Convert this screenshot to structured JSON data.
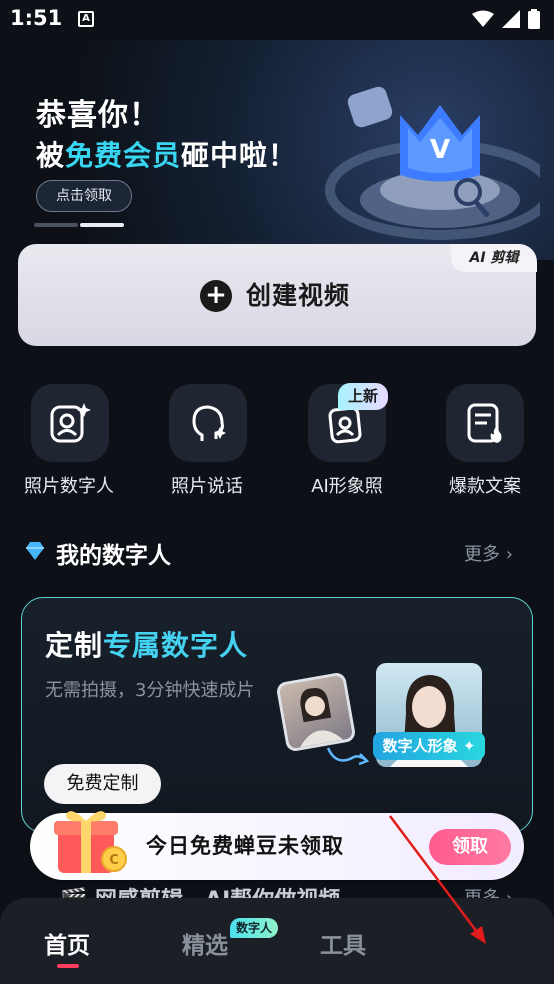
{
  "status": {
    "time": "1:51",
    "notification_icon": "A"
  },
  "banner": {
    "title_line1": "恭喜你！",
    "title_line2_prefix": "被",
    "title_line2_highlight": "免费会员",
    "title_line2_suffix": "砸中啦！",
    "button_label": "点击领取",
    "emblem_letter": "V"
  },
  "create": {
    "badge": "AI 剪辑",
    "label": "创建视频"
  },
  "tools": [
    {
      "label": "照片数字人"
    },
    {
      "label": "照片说话"
    },
    {
      "label": "AI形象照",
      "badge": "上新"
    },
    {
      "label": "爆款文案"
    }
  ],
  "my_dh": {
    "title": "我的数字人",
    "more": "更多 ›",
    "card_title_prefix": "定制",
    "card_title_highlight": "专属数字人",
    "card_sub": "无需拍摄，3分钟快速成片",
    "card_btn": "免费定制",
    "card_tag": "数字人形象"
  },
  "reward": {
    "text": "今日免费蝉豆未领取",
    "button": "领取"
  },
  "peek": {
    "text": "🎬 网感剪辑，AI帮你做视频",
    "more": "更多 ›"
  },
  "nav": {
    "items": [
      "首页",
      "精选",
      "工具"
    ],
    "badge": "数字人"
  },
  "colors": {
    "accent_cyan": "#39d6f2",
    "accent_pink": "#ff3e5f",
    "bg": "#0d1117"
  }
}
